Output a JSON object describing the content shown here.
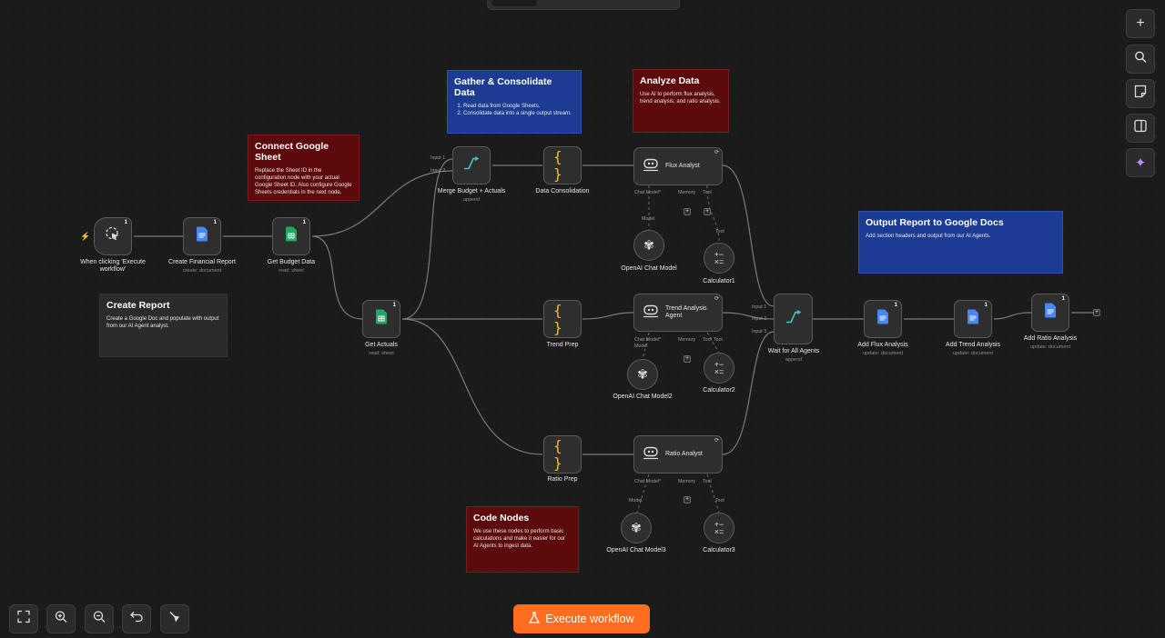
{
  "notes": {
    "connect": {
      "title": "Connect Google Sheet",
      "body": "Replace the Sheet ID in the configuration node with your actual Google Sheet ID. Also configure Google Sheets credentials in the next node."
    },
    "gather": {
      "title": "Gather & Consolidate Data",
      "items": [
        "Read data from Google Sheets.",
        "Consolidate data into a single output stream."
      ]
    },
    "analyze": {
      "title": "Analyze Data",
      "body": "Use AI to perform flux analysis, trend analysis, and ratio analysis."
    },
    "output": {
      "title": "Output Report to Google Docs",
      "body": "Add section headers and output from our AI Agents."
    },
    "create": {
      "title": "Create Report",
      "body": "Create a Google Doc and populate with output from our AI Agent analyst."
    },
    "code": {
      "title": "Code Nodes",
      "body": "We use these nodes to perform basic calculations and make it easier for our AI Agents to ingest data."
    }
  },
  "nodes": {
    "trigger": {
      "label": "When clicking 'Execute workflow'",
      "count": "1"
    },
    "create_report": {
      "label": "Create Financial Report",
      "sub": "create: document",
      "count": "1"
    },
    "get_budget": {
      "label": "Get Budget Data",
      "sub": "read: sheet",
      "count": "1"
    },
    "get_actuals": {
      "label": "Get Actuals",
      "sub": "read: sheet",
      "count": "1"
    },
    "merge": {
      "label": "Merge Budget + Actuals",
      "sub": "append",
      "input1": "Input 1",
      "input2": "Input 2"
    },
    "consolidation": {
      "label": "Data Consolidation"
    },
    "trend_prep": {
      "label": "Trend Prep"
    },
    "ratio_prep": {
      "label": "Ratio Prep"
    },
    "flux": {
      "label": "Flux Analyst",
      "chat": "Chat Model*",
      "memory": "Memory",
      "tool": "Tool"
    },
    "trend": {
      "label": "Trend Analysis Agent",
      "chat": "Chat Model*",
      "memory": "Memory",
      "tool": "Tool"
    },
    "ratio": {
      "label": "Ratio Analyst",
      "chat": "Chat Model*",
      "memory": "Memory",
      "tool": "Tool"
    },
    "model1": {
      "label": "OpenAI Chat Model",
      "tag": "Model"
    },
    "model2": {
      "label": "OpenAI Chat Model2",
      "tag": "Model"
    },
    "model3": {
      "label": "OpenAI Chat Model3",
      "tag": "Model"
    },
    "calc1": {
      "label": "Calculator1",
      "tag": "Tool"
    },
    "calc2": {
      "label": "Calculator2",
      "tag": "Tool"
    },
    "calc3": {
      "label": "Calculator3",
      "tag": "Tool"
    },
    "wait": {
      "label": "Wait for All Agents",
      "sub": "append",
      "input1": "Input 1",
      "input2": "Input 2",
      "input3": "Input 3"
    },
    "add_flux": {
      "label": "Add Flux Analysis",
      "sub": "update: document",
      "count": "1"
    },
    "add_trend": {
      "label": "Add Trend Analysis",
      "sub": "update: document",
      "count": "1"
    },
    "add_ratio": {
      "label": "Add Ratio Analysis",
      "sub": "update: document",
      "count": "1"
    }
  },
  "toolbar": {
    "execute_label": "Execute workflow"
  },
  "colors": {
    "accent": "#ff6d1f",
    "note_red": "#5c0a0c",
    "note_blue": "#1c3c93",
    "note_gray": "#2b2b2b",
    "background": "#1b1b1b"
  },
  "icons": {
    "right_toolbar": [
      "plus-icon",
      "search-icon",
      "sticky-note-icon",
      "panel-icon",
      "ai-sparkle-icon"
    ],
    "bottom_toolbar": [
      "fit-view-icon",
      "zoom-in-icon",
      "zoom-out-icon",
      "undo-icon",
      "tidy-up-icon"
    ]
  }
}
